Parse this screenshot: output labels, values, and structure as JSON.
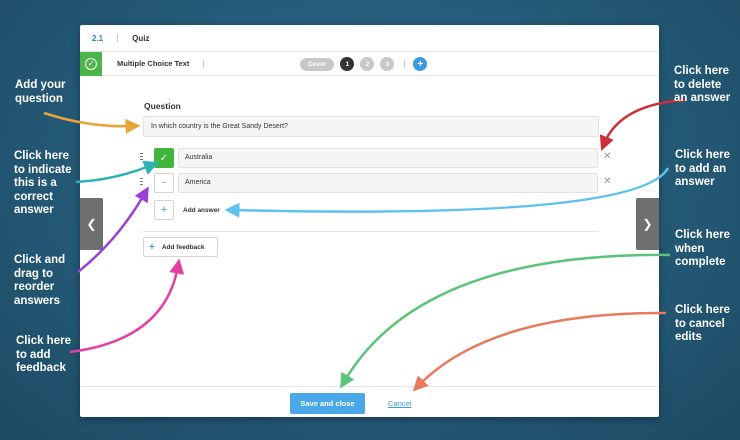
{
  "topbar": {
    "number": "2.1",
    "title": "Quiz"
  },
  "typebar": {
    "type_label": "Multiple Choice Text",
    "cover_label": "Cover",
    "steps": [
      "1",
      "2",
      "3"
    ],
    "add_step_label": "+"
  },
  "question": {
    "label": "Question",
    "value": "In which country is the Great Sandy Desert?"
  },
  "answers": [
    {
      "value": "Australia",
      "correct": true
    },
    {
      "value": "America",
      "correct": false
    }
  ],
  "add_answer_label": "Add answer",
  "add_feedback_label": "Add feedback",
  "footer": {
    "save_label": "Save and close",
    "cancel_label": "Cancel"
  },
  "callouts": {
    "add_question": "Add your question",
    "indicate_correct": "Click here to indicate this is a correct answer",
    "drag_reorder": "Click and drag to reorder answers",
    "add_feedback": "Click here to add feedback",
    "delete_answer": "Click here to delete an answer",
    "add_answer": "Click here to add an answer",
    "when_complete": "Click here when complete",
    "cancel_edits": "Click here to cancel edits"
  },
  "colors": {
    "background": "#245a77",
    "accent_blue": "#3a9ce0",
    "correct_green": "#3fb53c",
    "arrow_orange": "#e8a33a",
    "arrow_teal": "#2bb3b3",
    "arrow_purple": "#9b3fd6",
    "arrow_pink": "#e23fa3",
    "arrow_red": "#c9303a",
    "arrow_lightblue": "#5fc2ee",
    "arrow_green": "#5bc47a",
    "arrow_salmon": "#e97a60"
  }
}
